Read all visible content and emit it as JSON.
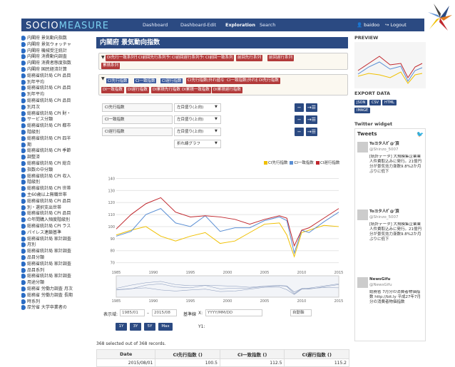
{
  "app": {
    "logo_a": "SOCIO",
    "logo_b": "MEASURE"
  },
  "nav": {
    "items": [
      "Dashboard",
      "Dashboard-Edit",
      "Exploration",
      "Search"
    ],
    "active": "Exploration",
    "user": "baidoo",
    "logout": "Logout"
  },
  "sidebar": {
    "items": [
      "内閣府 景気動向指数",
      "内閣府 景気ウォッチャ",
      "内閣府 機械受注統計",
      "内閣府 消費動向調査",
      "内閣府 消費者態度指数",
      "内閣府 国民経済計算",
      "総務省統計局 CPI 品目",
      "別年平均",
      "総務省統計局 CPI 品目",
      "別年平均",
      "総務省統計局 CPI 品目",
      "別月次",
      "総務省統計局 CPI 財・",
      "サービス分類",
      "総務省統計局 CPI 都市",
      "階級別",
      "総務省統計局 CPI 四半",
      "期",
      "総務省統計局 CPI 季節",
      "調整済",
      "総務省統計局 CPI 総合",
      "指数の中分類",
      "総務省統計局 CPI 収入",
      "階級別",
      "総務省統計局 CPI 世帯",
      "主60歳以上無職世帯",
      "総務省統計局 CPI 品目",
      "別・選択支出世帯",
      "総務省統計局 CPI 品目",
      "の年間購入頻度階級別",
      "総務省統計局 CPI ラス",
      "パイレス連鎖基準",
      "総務省統計局 家計調査",
      "月別",
      "総務省統計局 家計調査",
      "品目分類",
      "総務省統計局 家計調査",
      "品目系列",
      "総務省統計局 家計調査",
      "用途分類",
      "総務省 労働力調査 月次",
      "総務省 労働力調査 長期",
      "時系列",
      "厚労省 大学卒業者の"
    ]
  },
  "main": {
    "title": "内閣府 景気動向指数",
    "cat1": [
      "DI先行一致系列予測",
      "CI前回先行系列予想",
      "CI前回遅行系列予想",
      "CI前回一致系列",
      "前回先行系列",
      "前回遅行系列",
      "累積系列"
    ],
    "cat2": [
      "CI先行指数",
      "CI一致指数",
      "CI遅行指数",
      "CI先行指数(外れ値なし)",
      "CI一致指数(外れ値なし)",
      "DI先行指数",
      "DI一致指数",
      "DI遅行指数",
      "DI累積先行指数",
      "DI累積一致指数",
      "DI累積遅行指数"
    ],
    "rows": [
      {
        "label": "CI先行指数",
        "option": "左目盛り(上向)"
      },
      {
        "label": "CI一致指数",
        "option": "左目盛り(上向)"
      },
      {
        "label": "CI遅行指数",
        "option": "左目盛り(上向)"
      },
      {
        "label": "",
        "option": "折れ線グラフ"
      }
    ],
    "controls": {
      "range_label": "表示域:",
      "from": "1985/01",
      "dash": "–",
      "to": "2015/08",
      "base_label": "基準線",
      "x_label": "X:",
      "x_ph": "YYYY/MM/DD",
      "y_label": "Y1:",
      "y2_ph": "自動軸",
      "zoom": [
        "1Y",
        "3Y",
        "5Y",
        "Max"
      ]
    },
    "selected": "368 selected out of 368 records.",
    "table": {
      "headers": [
        "Date",
        "CI先行指数 ()",
        "CI一致指数 ()",
        "CI遅行指数 ()"
      ],
      "rows": [
        [
          "2015/08/01",
          "100.5",
          "112.5",
          "115.2"
        ]
      ]
    }
  },
  "chart_data": {
    "type": "line",
    "x": [
      1985,
      1987,
      1989,
      1991,
      1993,
      1995,
      1997,
      1999,
      2001,
      2003,
      2005,
      2007,
      2008,
      2009,
      2010,
      2011,
      2013,
      2015
    ],
    "xticks": [
      "1985",
      "1990",
      "1995",
      "2000",
      "2005",
      "2010",
      "2015"
    ],
    "yticks": [
      "140",
      "130",
      "120",
      "110",
      "100",
      "90",
      "80",
      "70"
    ],
    "ylim": [
      65,
      145
    ],
    "series": [
      {
        "name": "CI先行指数",
        "color": "#f0c000",
        "values": [
          93,
          97,
          100,
          92,
          88,
          92,
          95,
          86,
          88,
          95,
          102,
          103,
          93,
          75,
          95,
          97,
          101,
          100
        ]
      },
      {
        "name": "CI一致指数",
        "color": "#5b8fd4",
        "values": [
          92,
          96,
          110,
          115,
          103,
          100,
          109,
          96,
          99,
          99,
          105,
          108,
          105,
          78,
          97,
          95,
          104,
          112
        ]
      },
      {
        "name": "CI遅行指数",
        "color": "#c0272d",
        "values": [
          98,
          110,
          119,
          124,
          112,
          108,
          109,
          108,
          106,
          102,
          106,
          109,
          107,
          84,
          97,
          99,
          107,
          115
        ]
      }
    ],
    "nav_ticks": [
      "1985",
      "1990",
      "1995",
      "2000",
      "2005",
      "2010",
      "2015"
    ]
  },
  "right": {
    "preview": "PREVIEW",
    "export": "EXPORT DATA",
    "export_btns": [
      "JSON",
      "CSV",
      "HTML"
    ],
    "image_btn": "IMAGE",
    "twitter": "Twitter widget",
    "tweets_hdr": "Tweets",
    "tweets": [
      {
        "name": "Toヨタ人ｾﾞ@'頂",
        "handle": "@Shinzo_5007",
        "text": "[統計データ] 大規模集企業業人件費取込みに発行。21億円分が景気効力漸数9.8%2か月ぶりに低下"
      },
      {
        "name": "Toヨタ人ｾﾞ@'頂",
        "handle": "@Shinzo_5007",
        "text": "[統計データ] 大規模集企業業人件費取込みに発行。21億円分が景気効力漸数9.8%2か月ぶりに低下"
      },
      {
        "name": "NewsGifu",
        "handle": "@NewsGifu",
        "text": "総務省 7月分の消費者物価指数 http://bit.ly 平成27年7月分の消費者物価指数"
      }
    ]
  }
}
